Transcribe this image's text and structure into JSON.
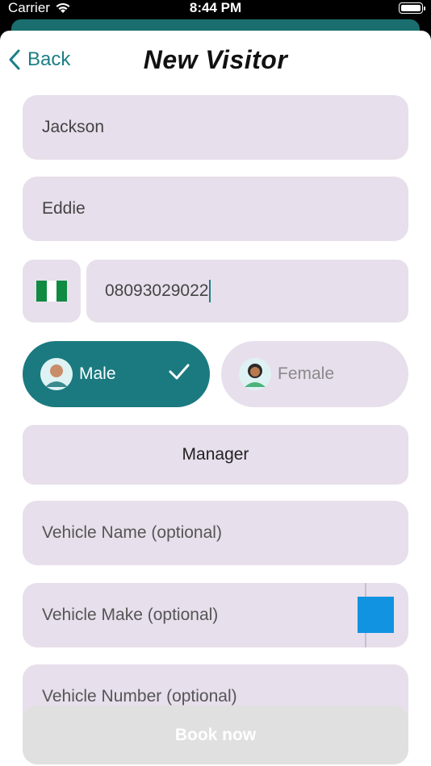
{
  "status_bar": {
    "carrier": "Carrier",
    "time": "8:44 PM"
  },
  "nav": {
    "back_label": "Back",
    "title": "New Visitor"
  },
  "form": {
    "last_name": "Jackson",
    "first_name": "Eddie",
    "country_flag": "🇳🇬",
    "phone": "08093029022",
    "gender_male_label": "Male",
    "gender_female_label": "Female",
    "selected_gender": "Male",
    "role": "Manager",
    "vehicle_name_placeholder": "Vehicle Name (optional)",
    "vehicle_make_placeholder": "Vehicle Make (optional)",
    "vehicle_number_placeholder": "Vehicle Number (optional)",
    "vehicle_color": "#1193e1"
  },
  "actions": {
    "book_label": "Book now"
  },
  "colors": {
    "accent": "#1a7a80",
    "field_bg": "#e7dfec",
    "disabled_button": "#e0e0e0"
  }
}
